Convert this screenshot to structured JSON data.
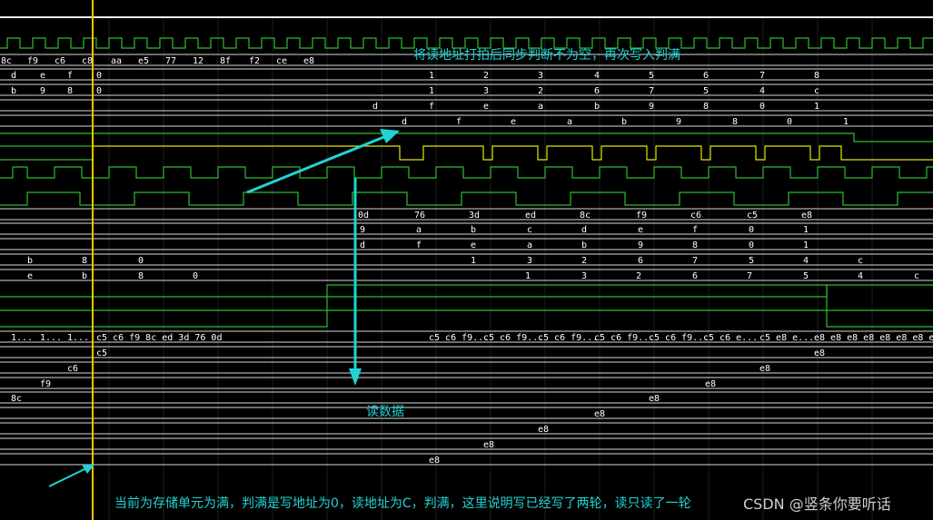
{
  "annotations": {
    "top_note": "将读地址打拍后同步判断不为空，再次写入判满",
    "mid_note": "读数据",
    "bottom_note": "当前为存储单元为满，判满是写地址为0，读地址为C，判满，这里说明写已经写了两轮，读只读了一轮"
  },
  "watermark": "CSDN @竖条你要听话",
  "colors": {
    "background": "#000000",
    "wave_green": "#2ebd2e",
    "bus_white": "#e8e8e8",
    "cursor": "#f5c400",
    "annotation": "#22d3d3",
    "flag_yellow": "#e5e500"
  },
  "bus_rows": [
    {
      "values": [
        "8c",
        "f9",
        "c6",
        "c8",
        "aa",
        "e5",
        "77",
        "12",
        "8f",
        "f2",
        "ce",
        "e8"
      ]
    },
    {
      "values": [
        "d",
        "e",
        "f",
        "0",
        "1",
        "2",
        "3",
        "4",
        "5",
        "6",
        "7",
        "8"
      ]
    },
    {
      "values": [
        "b",
        "9",
        "8",
        "0",
        "1",
        "3",
        "2",
        "6",
        "7",
        "5",
        "4",
        "c"
      ]
    },
    {
      "values": [
        "d",
        "f",
        "e",
        "a",
        "b",
        "9",
        "8",
        "0",
        "1"
      ]
    },
    {
      "values": [
        "d",
        "f",
        "e",
        "a",
        "b",
        "9",
        "8",
        "0",
        "1"
      ]
    },
    {
      "values": [
        "0d",
        "76",
        "3d",
        "ed",
        "8c",
        "f9",
        "c6",
        "c5",
        "e8"
      ]
    },
    {
      "values": [
        "9",
        "a",
        "b",
        "c",
        "d",
        "e",
        "f",
        "0",
        "1"
      ]
    },
    {
      "values": [
        "d",
        "f",
        "e",
        "a",
        "b",
        "9",
        "8",
        "0",
        "1"
      ]
    },
    {
      "values": [
        "b",
        "8",
        "0",
        "1",
        "3",
        "2",
        "6",
        "7",
        "5",
        "4",
        "c"
      ]
    },
    {
      "values": [
        "e",
        "b",
        "8",
        "0",
        "1",
        "3",
        "2",
        "6",
        "7",
        "5",
        "4",
        "c"
      ]
    },
    {
      "values": [
        "1...",
        "1...",
        "1...",
        "c5 c6 f9 8c ed 3d 76 0d",
        "c5 c6 f9...",
        "c5 c6 f9...",
        "c5 c6 f9...",
        "c5 c6 f9...",
        "c5 c6 f9...",
        "c5 c6 e...",
        "c5 e8 e...",
        "e8 e8 e8 e8 e8 e8 e8 e8"
      ]
    },
    {
      "values": [
        "c5",
        "e8"
      ]
    },
    {
      "values": [
        "c6",
        "e8"
      ]
    },
    {
      "values": [
        "f9",
        "e8"
      ]
    },
    {
      "values": [
        "8c",
        "e8"
      ]
    },
    {
      "values": [
        "e8"
      ]
    },
    {
      "values": [
        "e8"
      ]
    },
    {
      "values": [
        "e8"
      ]
    },
    {
      "values": [
        "e8"
      ]
    }
  ]
}
